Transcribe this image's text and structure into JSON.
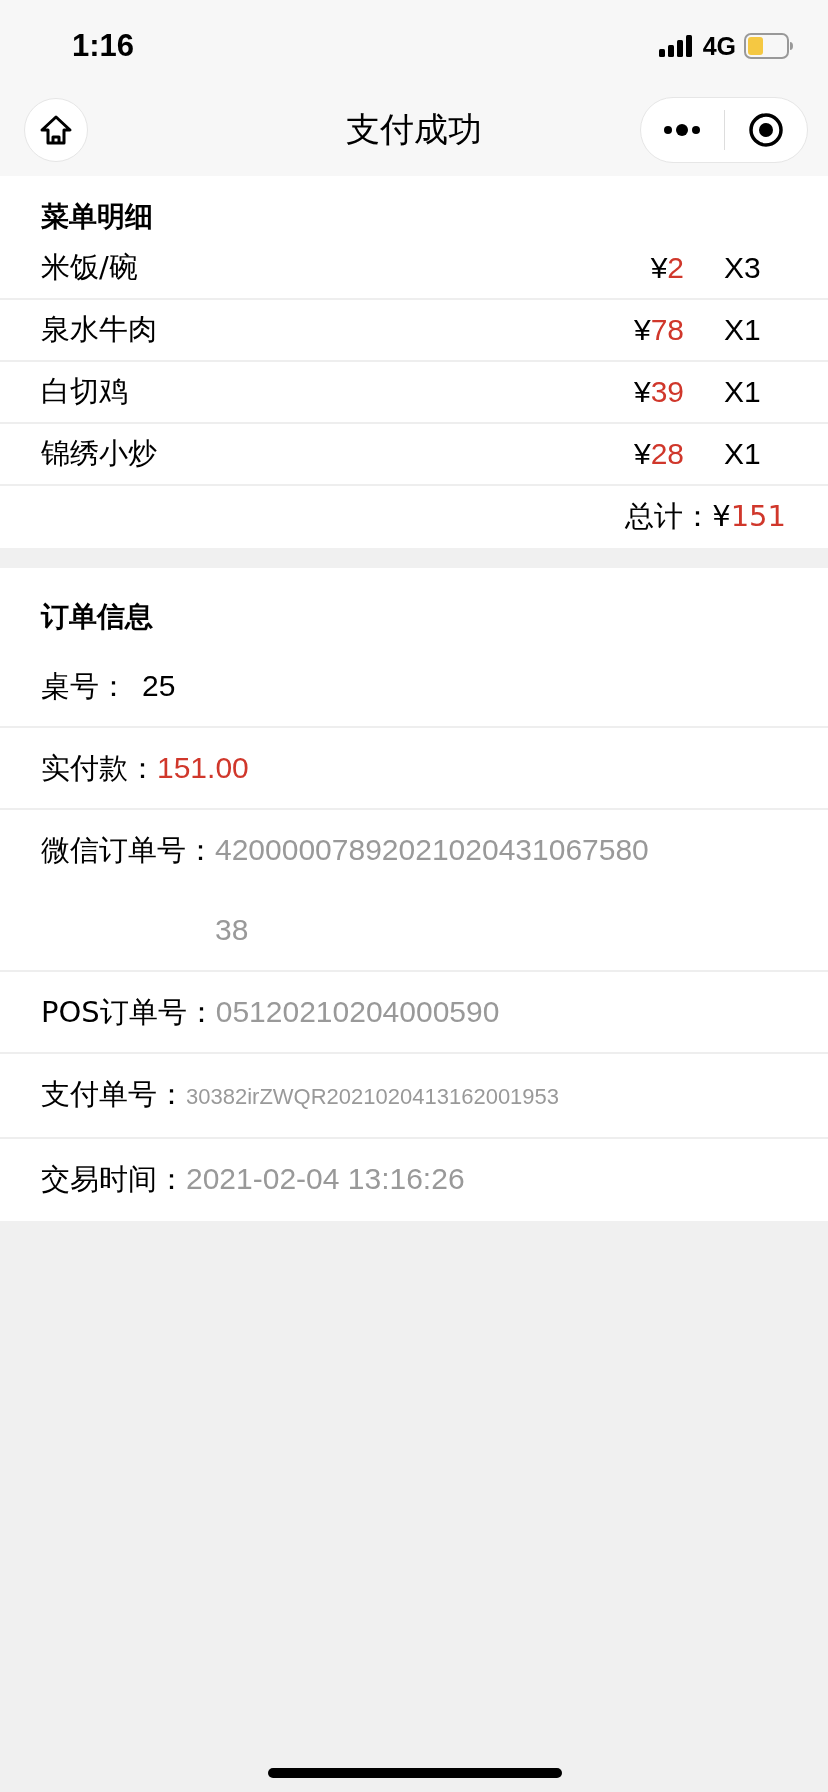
{
  "status_bar": {
    "time": "1:16",
    "network": "4G"
  },
  "nav_bar": {
    "title": "支付成功"
  },
  "menu": {
    "title": "菜单明细",
    "items": [
      {
        "name": "米饭/碗",
        "currency": "¥",
        "price": "2",
        "quantity": "X3"
      },
      {
        "name": "泉水牛肉",
        "currency": "¥",
        "price": "78",
        "quantity": "X1"
      },
      {
        "name": "白切鸡",
        "currency": "¥",
        "price": "39",
        "quantity": "X1"
      },
      {
        "name": "锦绣小炒",
        "currency": "¥",
        "price": "28",
        "quantity": "X1"
      }
    ],
    "total": {
      "label": "总计：",
      "currency": "¥",
      "amount": "151"
    }
  },
  "order_info": {
    "title": "订单信息",
    "rows": [
      {
        "label": "桌号：",
        "value": "25",
        "kind": "plain"
      },
      {
        "label": "实付款：",
        "value": "151.00",
        "kind": "amount"
      },
      {
        "label": "微信订单号：",
        "value": "4200000789202102043106758038",
        "kind": "muted"
      },
      {
        "label": "POS订单号：",
        "value": "05120210204000590",
        "kind": "muted"
      },
      {
        "label": "支付单号：",
        "value": "30382irZWQR2021020413162001953",
        "kind": "small"
      },
      {
        "label": "交易时间：",
        "value": "2021-02-04 13:16:26",
        "kind": "muted"
      }
    ]
  }
}
